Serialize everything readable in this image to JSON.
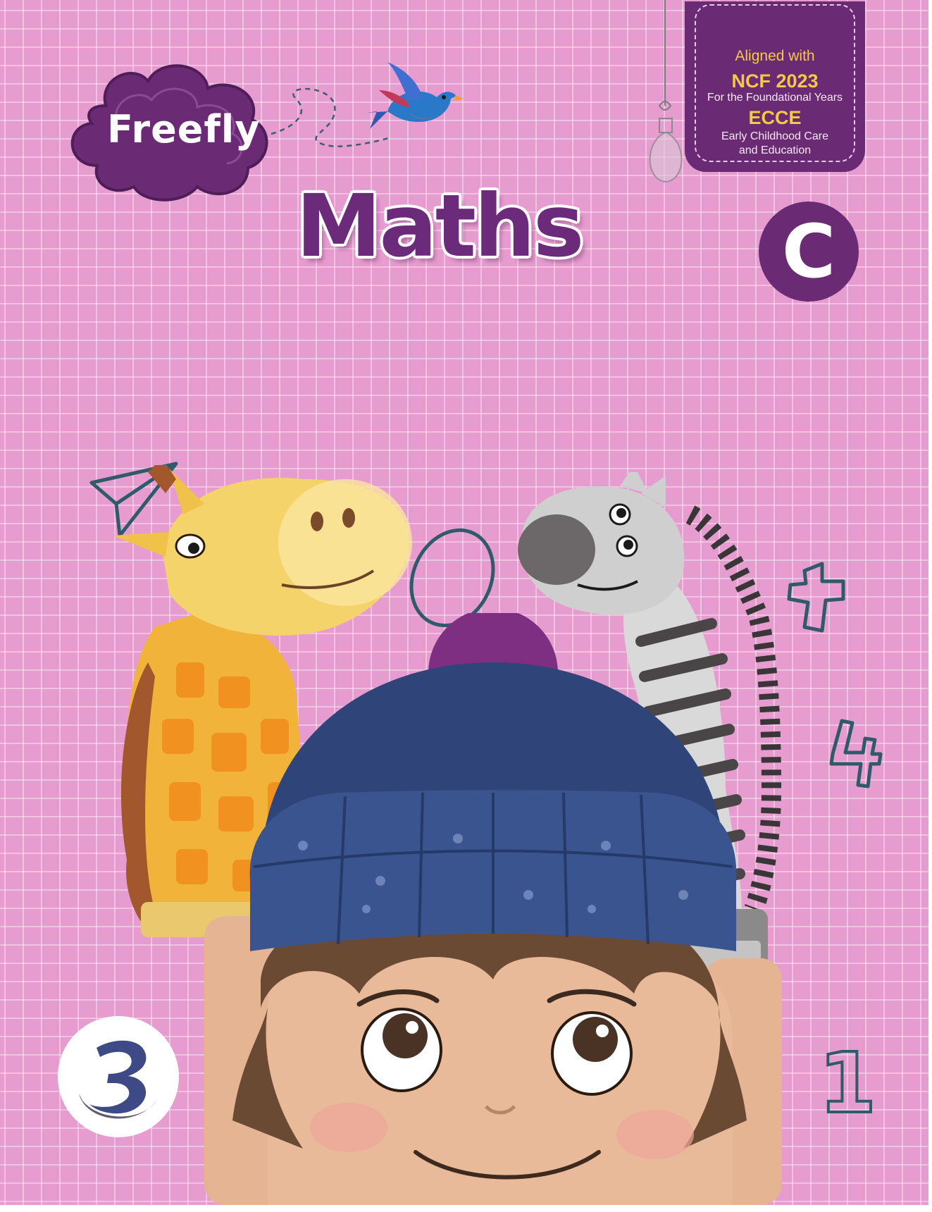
{
  "cover": {
    "series_name": "Freefly",
    "subject_title": "Maths",
    "level_letter": "C",
    "book_number": "1",
    "colors": {
      "background": "#e79ccf",
      "grid": "#ffffff",
      "brand_purple": "#6a2b74",
      "badge_yellow": "#f4c945",
      "doodle_teal": "#2f5a6a"
    }
  },
  "badge": {
    "aligned_label": "Aligned with",
    "ncf_label": "NCF 2023",
    "ncf_subtitle": "For the Foundational Years",
    "ecce_label": "ECCE",
    "ecce_line1": "Early Childhood Care",
    "ecce_line2": "and Education"
  },
  "icons": {
    "cloud_logo": "cloud-icon",
    "bird": "bird-icon",
    "light_bulb": "light-bulb-icon",
    "paper_plane": "paper-plane-icon",
    "zero_doodle": "zero-doodle-icon",
    "plus_doodle": "plus-doodle-icon",
    "four_doodle": "four-doodle-icon",
    "publisher_logo": "publisher-logo-icon"
  }
}
